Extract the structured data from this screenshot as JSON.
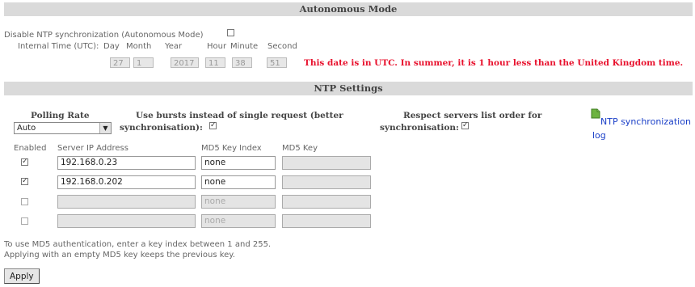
{
  "autonomous": {
    "title": "Autonomous Mode",
    "disable_label": "Disable NTP synchronization (Autonomous Mode)",
    "internal_time_label": "Internal Time (UTC):",
    "time_headers": [
      "Day",
      "Month",
      "Year",
      "Hour",
      "Minute",
      "Second"
    ],
    "time_values": [
      "27",
      "1",
      "2017",
      "11",
      "38",
      "51"
    ],
    "utc_notice": "This date is in UTC. In summer, it is 1 hour less than the United Kingdom time.",
    "notice_color": "#e8112d"
  },
  "ntp": {
    "title": "NTP Settings",
    "polling_rate_label": "Polling Rate",
    "polling_rate_value": "Auto",
    "bursts_label_1": "Use bursts instead of single request (better",
    "bursts_label_2": "synchronisation):",
    "respect_label_1": "Respect servers list order for",
    "respect_label_2": "synchronisation:",
    "log_link_1": "NTP synchronization",
    "log_link_2": "log",
    "link_color": "#1a3fc8",
    "columns": [
      "Enabled",
      "Server IP Address",
      "MD5 Key Index",
      "MD5 Key"
    ],
    "servers": [
      {
        "ip": "192.168.0.23",
        "key_index": "none",
        "key": ""
      },
      {
        "ip": "192.168.0.202",
        "key_index": "none",
        "key": ""
      },
      {
        "ip": "",
        "key_index": "none",
        "key": ""
      },
      {
        "ip": "",
        "key_index": "none",
        "key": ""
      }
    ],
    "note_1": "To use MD5 authentication, enter a key index between 1 and 255.",
    "note_2": "Applying with an empty MD5 key keeps the previous key."
  },
  "apply_label": "Apply"
}
